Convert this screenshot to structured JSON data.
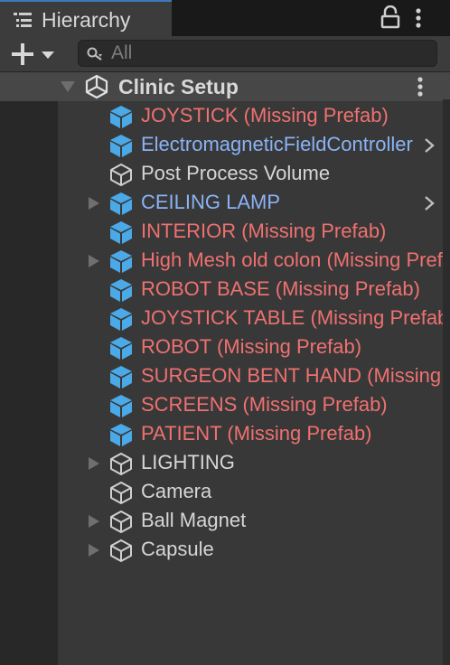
{
  "tab": {
    "title": "Hierarchy"
  },
  "search": {
    "placeholder": "All"
  },
  "scene": {
    "name": "Clinic Setup"
  },
  "items": [
    {
      "label": "JOYSTICK (Missing Prefab)",
      "kind": "missing",
      "icon": "prefab-cube-icon",
      "has_children": false,
      "has_chevron": false
    },
    {
      "label": "ElectromagneticFieldController",
      "kind": "prefab",
      "icon": "prefab-cube-icon",
      "has_children": false,
      "has_chevron": true
    },
    {
      "label": "Post Process Volume",
      "kind": "normal",
      "icon": "gameobject-cube-icon",
      "has_children": false,
      "has_chevron": false
    },
    {
      "label": "CEILING LAMP",
      "kind": "prefab",
      "icon": "prefab-cube-icon",
      "has_children": true,
      "has_chevron": true
    },
    {
      "label": "INTERIOR (Missing Prefab)",
      "kind": "missing",
      "icon": "prefab-cube-icon",
      "has_children": false,
      "has_chevron": false
    },
    {
      "label": "High Mesh old colon (Missing Prefab)",
      "kind": "missing",
      "icon": "prefab-cube-icon",
      "has_children": true,
      "has_chevron": false
    },
    {
      "label": "ROBOT BASE (Missing Prefab)",
      "kind": "missing",
      "icon": "prefab-cube-icon",
      "has_children": false,
      "has_chevron": false
    },
    {
      "label": "JOYSTICK TABLE (Missing Prefab)",
      "kind": "missing",
      "icon": "prefab-cube-icon",
      "has_children": false,
      "has_chevron": false
    },
    {
      "label": "ROBOT (Missing Prefab)",
      "kind": "missing",
      "icon": "prefab-cube-icon",
      "has_children": false,
      "has_chevron": false
    },
    {
      "label": "SURGEON BENT HAND (Missing Prefab)",
      "kind": "missing",
      "icon": "prefab-cube-icon",
      "has_children": false,
      "has_chevron": false
    },
    {
      "label": "SCREENS (Missing Prefab)",
      "kind": "missing",
      "icon": "prefab-cube-icon",
      "has_children": false,
      "has_chevron": false
    },
    {
      "label": "PATIENT (Missing Prefab)",
      "kind": "missing",
      "icon": "prefab-cube-icon",
      "has_children": false,
      "has_chevron": false
    },
    {
      "label": "LIGHTING",
      "kind": "normal",
      "icon": "gameobject-cube-icon",
      "has_children": true,
      "has_chevron": false
    },
    {
      "label": "Camera",
      "kind": "normal",
      "icon": "gameobject-cube-icon",
      "has_children": false,
      "has_chevron": false
    },
    {
      "label": "Ball Magnet",
      "kind": "normal",
      "icon": "gameobject-cube-icon",
      "has_children": true,
      "has_chevron": false
    },
    {
      "label": "Capsule",
      "kind": "normal",
      "icon": "gameobject-cube-icon",
      "has_children": true,
      "has_chevron": false
    }
  ],
  "colors": {
    "missing_prefab": "#ee7170",
    "prefab": "#8ab3f5",
    "normal": "#d6d6d6",
    "prefab_icon": "#4aa9e6"
  }
}
